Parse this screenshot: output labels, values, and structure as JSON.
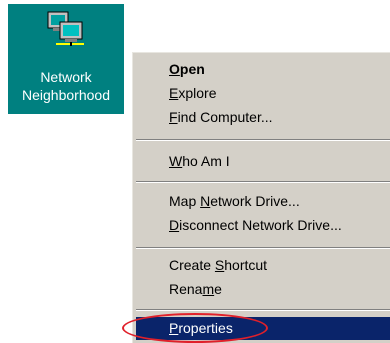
{
  "desktop": {
    "icon": {
      "name": "network-neighborhood-icon",
      "label_line1": "Network",
      "label_line2": "Neighborhood"
    },
    "background_color": "#008080"
  },
  "context_menu": {
    "items": [
      {
        "id": "open",
        "pre": "",
        "key": "O",
        "post": "pen",
        "bold": true
      },
      {
        "id": "explore",
        "pre": "",
        "key": "E",
        "post": "xplore"
      },
      {
        "id": "find-computer",
        "pre": "",
        "key": "F",
        "post": "ind Computer..."
      },
      {
        "id": "who-am-i",
        "pre": "",
        "key": "W",
        "post": "ho Am I"
      },
      {
        "id": "map-network-drive",
        "pre": "Map ",
        "key": "N",
        "post": "etwork Drive..."
      },
      {
        "id": "disconnect-network-drive",
        "pre": "",
        "key": "D",
        "post": "isconnect Network Drive..."
      },
      {
        "id": "create-shortcut",
        "pre": "Create ",
        "key": "S",
        "post": "hortcut"
      },
      {
        "id": "rename",
        "pre": "Rena",
        "key": "m",
        "post": "e"
      },
      {
        "id": "properties",
        "pre": "",
        "key": "P",
        "post": "roperties",
        "selected": true
      }
    ],
    "selected_color": "#0a246a",
    "annotation_color": "#e0202a"
  }
}
